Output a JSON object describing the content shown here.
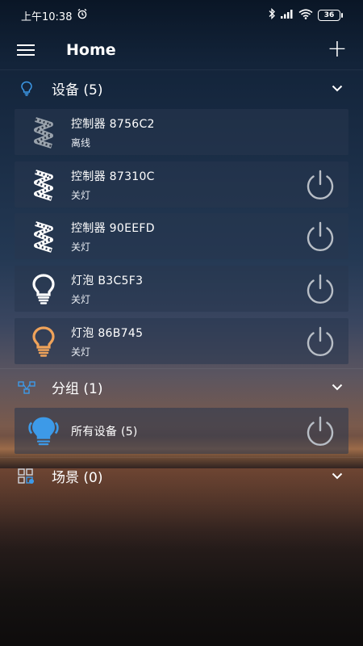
{
  "status_bar": {
    "time": "上午10:38",
    "battery": "36"
  },
  "app_bar": {
    "title": "Home",
    "menu_icon": "hamburger-menu-icon",
    "add_label": "+"
  },
  "devices_section": {
    "title": "设备 (5)",
    "icon": "lightbulb-outline-icon",
    "items": [
      {
        "name": "控制器  8756C2",
        "state": "离线",
        "icon": "led-strip-icon",
        "icon_color": "#9aa3ad",
        "has_power": false
      },
      {
        "name": "控制器  87310C",
        "state": "关灯",
        "icon": "led-strip-icon",
        "icon_color": "#ffffff",
        "has_power": true
      },
      {
        "name": "控制器  90EEFD",
        "state": "关灯",
        "icon": "led-strip-icon",
        "icon_color": "#ffffff",
        "has_power": true
      },
      {
        "name": "灯泡  B3C5F3",
        "state": "关灯",
        "icon": "bulb-icon",
        "icon_color": "#ffffff",
        "has_power": true
      },
      {
        "name": "灯泡  86B745",
        "state": "关灯",
        "icon": "bulb-icon",
        "icon_color": "#f0a35a",
        "has_power": true
      }
    ]
  },
  "groups_section": {
    "title": "分组 (1)",
    "icon": "group-network-icon",
    "items": [
      {
        "name": "所有设备 (5)",
        "icon": "group-bulb-icon",
        "icon_color": "#3d9ae8",
        "has_power": true
      }
    ]
  },
  "scenes_section": {
    "title": "场景 (0)",
    "icon": "scene-grid-icon"
  },
  "colors": {
    "accent_blue": "#3d9ae8",
    "bulb_orange": "#f0a35a",
    "power_gray": "#b8bec6"
  }
}
